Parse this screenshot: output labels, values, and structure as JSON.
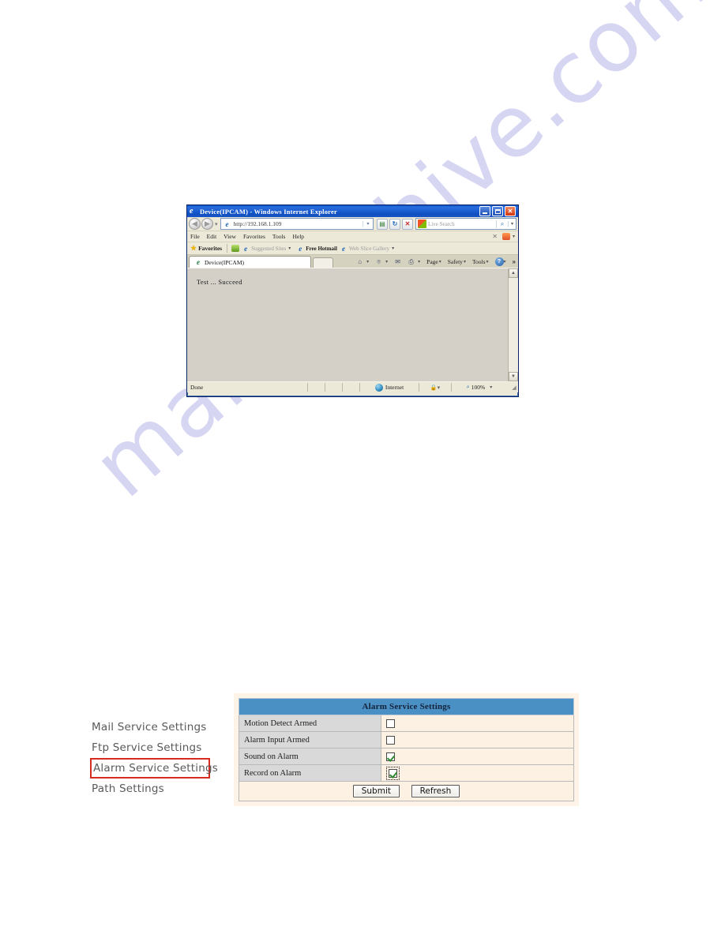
{
  "watermark": {
    "text": "manualshive.com"
  },
  "browser_window": {
    "title": "Device(IPCAM) - Windows Internet Explorer",
    "window_controls": {
      "minimize": "_",
      "maximize": "□",
      "close": "✕"
    },
    "navigation": {
      "back_label": "◀",
      "forward_label": "▶",
      "history_caret": "▾",
      "address_value": "http://192.168.1.109",
      "address_caret": "▾",
      "refresh_label": "↻",
      "stop_label": "✕",
      "go_label": "➜"
    },
    "search": {
      "placeholder": "Live Search",
      "go_label": "⌕",
      "caret": "▾"
    },
    "menubar": {
      "items": [
        "File",
        "Edit",
        "View",
        "Favorites",
        "Tools",
        "Help"
      ],
      "close_label": "✕",
      "feed_caret": "▾"
    },
    "favorites_bar": {
      "favorites_label": "Favorites",
      "items": [
        {
          "label": "Suggested Sites",
          "caret": "▾",
          "dim": true
        },
        {
          "label": "Free Hotmail",
          "caret": "",
          "dim": false
        },
        {
          "label": "Web Slice Gallery",
          "caret": "▾",
          "dim": true
        }
      ]
    },
    "tab": {
      "label": "Device(IPCAM)"
    },
    "command_bar": {
      "home_icon": "⌂",
      "home_caret": "▾",
      "feeds_icon": "⌾",
      "mail_icon": "✉",
      "print_icon": "⎙",
      "print_caret": "▾",
      "page_label": "Page",
      "page_caret": "▾",
      "safety_label": "Safety",
      "safety_caret": "▾",
      "tools_label": "Tools",
      "tools_caret": "▾",
      "help_label": "?",
      "help_caret": "▾",
      "overflow_label": "»"
    },
    "page_content": {
      "message": "Test  ...   Succeed"
    },
    "scrollbar": {
      "up": "▲",
      "down": "▼"
    },
    "statusbar": {
      "status": "Done",
      "zone": "Internet",
      "lock_icon": "🔒",
      "lock_caret": "▾",
      "zoom_level": "100%",
      "zoom_caret": "▾",
      "grip": "◢"
    }
  },
  "side_menu": {
    "items": [
      {
        "label": "Mail Service Settings",
        "highlighted": false
      },
      {
        "label": "Ftp Service Settings",
        "highlighted": false
      },
      {
        "label": "Alarm Service Settings",
        "highlighted": true
      },
      {
        "label": "Path Settings",
        "highlighted": false
      }
    ],
    "highlight_color": "#d62b1f"
  },
  "settings_panel": {
    "header": "Alarm Service Settings",
    "header_color": "#4a90c4",
    "rows": [
      {
        "label": "Motion Detect Armed",
        "checked": false,
        "focused": false
      },
      {
        "label": "Alarm Input Armed",
        "checked": false,
        "focused": false
      },
      {
        "label": "Sound on Alarm",
        "checked": true,
        "focused": false
      },
      {
        "label": "Record on Alarm",
        "checked": true,
        "focused": true
      }
    ],
    "buttons": {
      "submit": "Submit",
      "refresh": "Refresh"
    }
  }
}
